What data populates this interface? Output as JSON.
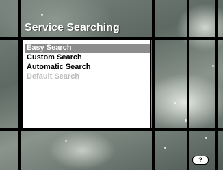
{
  "header": {
    "title": "Service Searching"
  },
  "menu": {
    "items": [
      {
        "label": "Easy Search",
        "state": "selected"
      },
      {
        "label": "Custom Search",
        "state": "normal"
      },
      {
        "label": "Automatic Search",
        "state": "normal"
      },
      {
        "label": "Default Search",
        "state": "disabled"
      }
    ]
  },
  "help": {
    "label": "?"
  },
  "colors": {
    "highlight": "#8c8c8c",
    "panel": "#ffffff",
    "disabled_text": "#bdbdbd",
    "frame_lines": "#000000"
  }
}
